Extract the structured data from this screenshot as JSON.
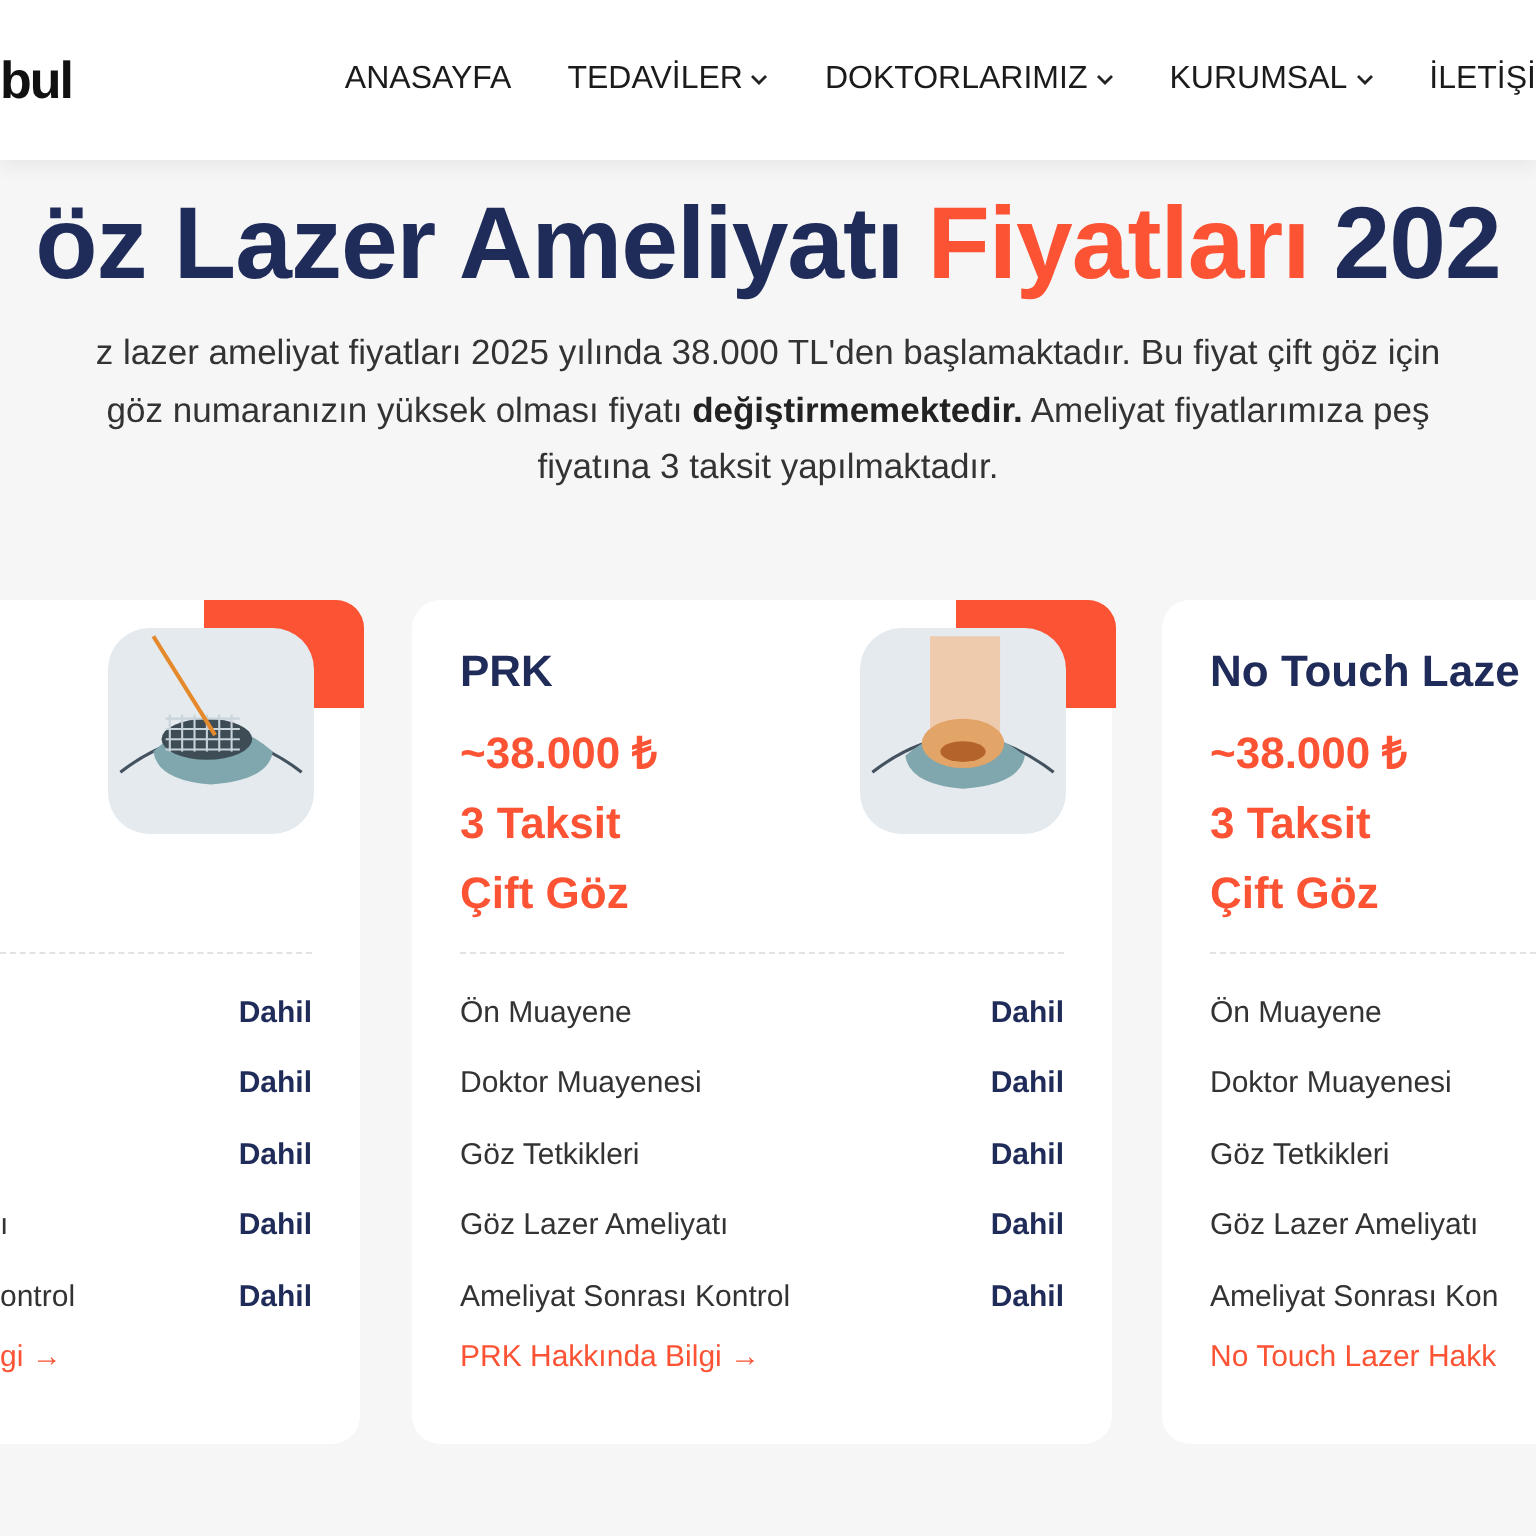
{
  "header": {
    "logo_text": "bul",
    "nav": [
      {
        "label": "ANASAYFA",
        "has_dropdown": false
      },
      {
        "label": "TEDAVİLER",
        "has_dropdown": true
      },
      {
        "label": "DOKTORLARIMIZ",
        "has_dropdown": true
      },
      {
        "label": "KURUMSAL",
        "has_dropdown": true
      },
      {
        "label": "İLETİŞİ",
        "has_dropdown": false
      }
    ]
  },
  "hero": {
    "title_parts": [
      {
        "text": "öz Lazer Ameliyatı",
        "highlight": false
      },
      {
        "text": "Fiyatları",
        "highlight": true
      },
      {
        "text": "202",
        "highlight": false
      }
    ],
    "intro": "z lazer ameliyat fiyatları 2025 yılında 38.000 TL'den başlamaktadır. Bu fiyat çift göz için\ngöz numaranızın yüksek olması fiyatı **değiştirmemektedir.** Ameliyat fiyatlarımıza peş\nfiyatına 3 taksit yapılmaktadır."
  },
  "cards": [
    {
      "kind": "laser-grid",
      "rows": [
        {
          "value": "Dahil"
        },
        {
          "value": "Dahil"
        },
        {
          "value": "Dahil"
        },
        {
          "label": "ı",
          "value": "Dahil"
        },
        {
          "label": "ontrol",
          "value": "Dahil"
        }
      ],
      "link": "gi →"
    },
    {
      "title": "PRK",
      "price_lines": [
        "~38.000 ₺",
        "3 Taksit",
        "Çift Göz"
      ],
      "kind": "laser-beam",
      "rows": [
        {
          "label": "Ön Muayene",
          "value": "Dahil"
        },
        {
          "label": "Doktor Muayenesi",
          "value": "Dahil"
        },
        {
          "label": "Göz Tetkikleri",
          "value": "Dahil"
        },
        {
          "label": "Göz Lazer Ameliyatı",
          "value": "Dahil"
        },
        {
          "label": "Ameliyat Sonrası Kontrol",
          "value": "Dahil"
        }
      ],
      "link": "PRK Hakkında Bilgi →"
    },
    {
      "title": "No Touch Laze",
      "price_lines": [
        "~38.000 ₺",
        "3 Taksit",
        "Çift Göz"
      ],
      "rows": [
        {
          "label": "Ön Muayene"
        },
        {
          "label": "Doktor Muayenesi"
        },
        {
          "label": "Göz Tetkikleri"
        },
        {
          "label": "Göz Lazer Ameliyatı"
        },
        {
          "label": "Ameliyat Sonrası Kon"
        }
      ],
      "link": "No Touch Lazer Hakk"
    }
  ]
}
